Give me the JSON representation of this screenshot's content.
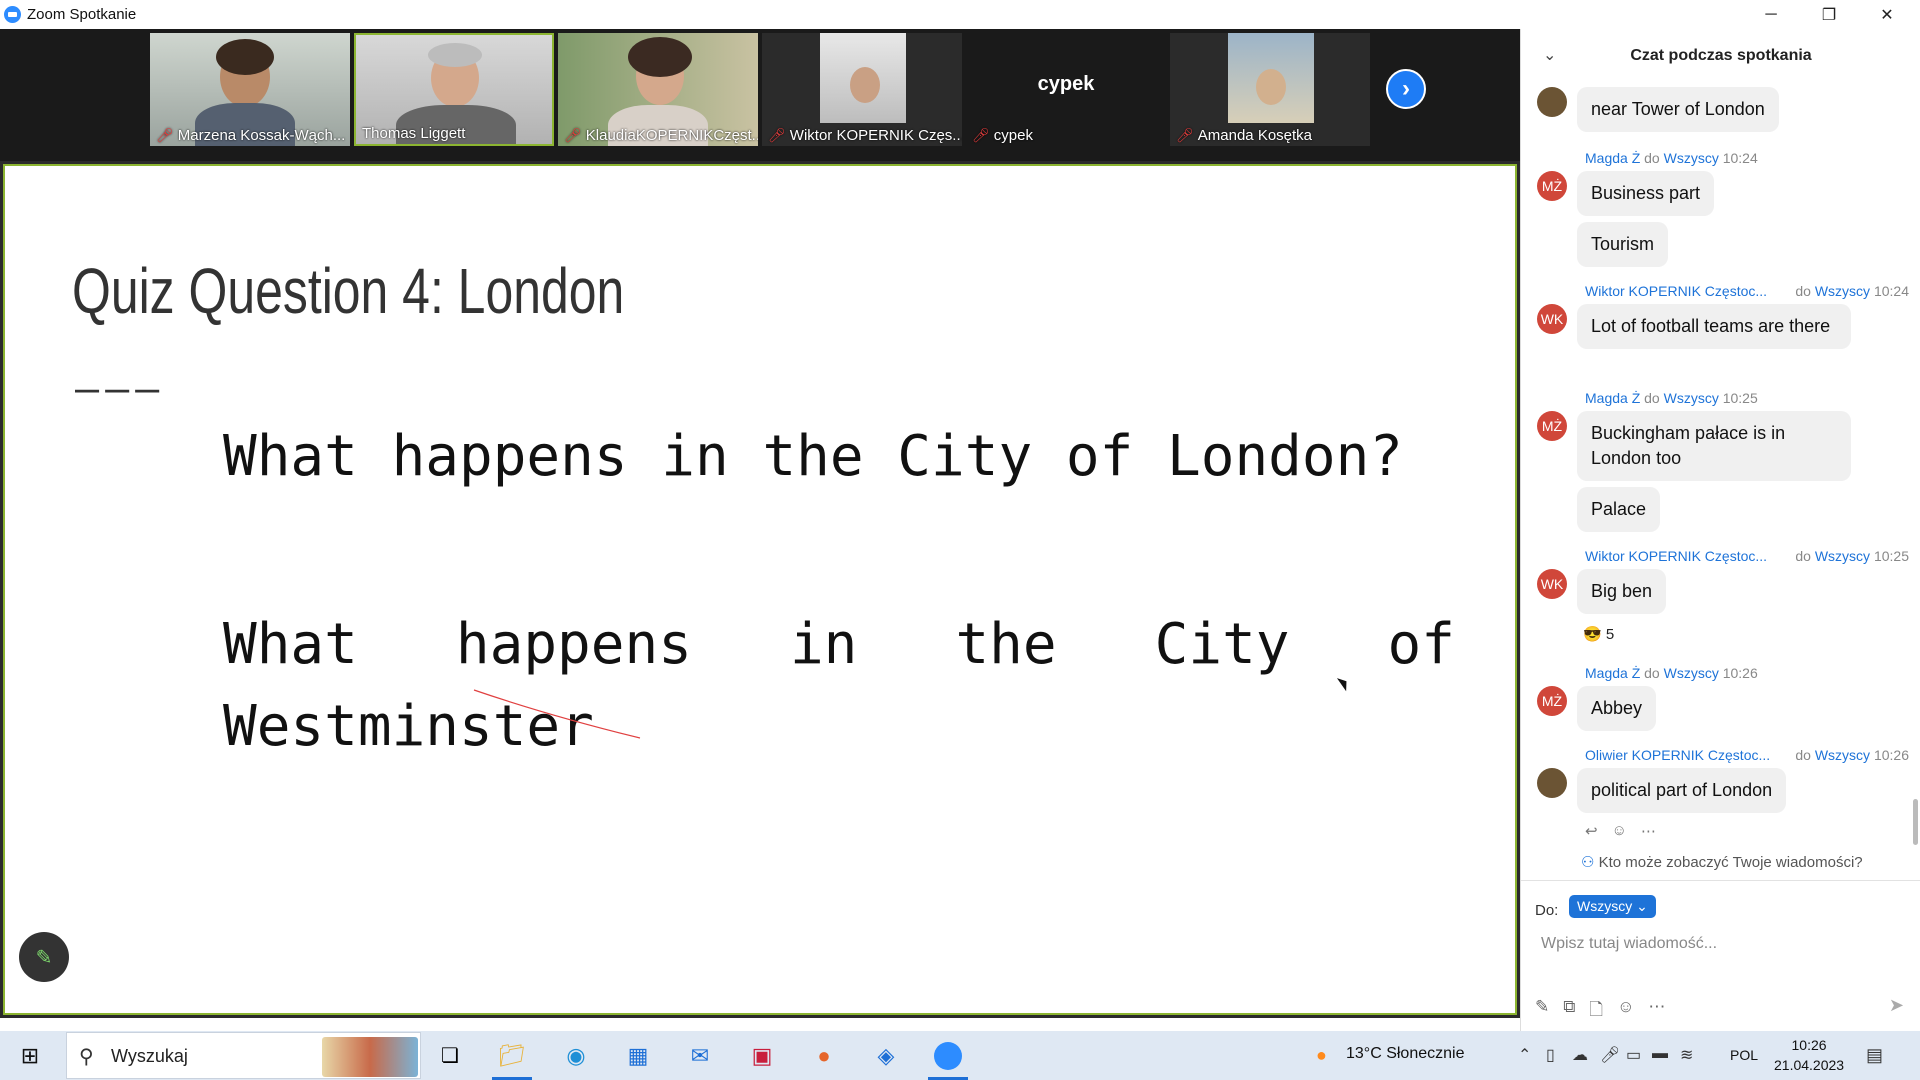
{
  "window": {
    "title": "Zoom Spotkanie",
    "minimize": "─",
    "maximize": "❐",
    "close": "✕"
  },
  "participants": [
    {
      "name": "Marzena Kossak-Wąch...",
      "muted": true
    },
    {
      "name": "Thomas Liggett",
      "muted": false
    },
    {
      "name": "KlaudiaKOPERNIKCzęst...",
      "muted": true
    },
    {
      "name": "Wiktor KOPERNIK Częs...",
      "muted": true
    },
    {
      "name": "cypek",
      "muted": true,
      "video_label": "cypek"
    },
    {
      "name": "Amanda Kosętka",
      "muted": true
    }
  ],
  "slide": {
    "title": "Quiz Question 4: London",
    "dashes": "———",
    "line1": "What happens in the City of London?",
    "line2": "What happens in the City of Westminster"
  },
  "chat": {
    "header": "Czat podczas spotkania",
    "messages": [
      {
        "avatar": "",
        "sender": "",
        "to": "",
        "time": "",
        "text": "near Tower of London"
      },
      {
        "avatar": "MŻ",
        "sender": "Magda Ż",
        "to_word": "do",
        "to": "Wszyscy",
        "time": "10:24",
        "texts": [
          "Business part",
          "Tourism"
        ]
      },
      {
        "avatar": "WK",
        "sender": "Wiktor KOPERNIK Częstoc...",
        "to_word": "do",
        "to": "Wszyscy",
        "time": "10:24",
        "texts": [
          "Lot of football teams are there"
        ]
      },
      {
        "avatar": "MŻ",
        "sender": "Magda Ż",
        "to_word": "do",
        "to": "Wszyscy",
        "time": "10:25",
        "texts": [
          "Buckingham pałace is in London too",
          "Palace"
        ]
      },
      {
        "avatar": "WK",
        "sender": "Wiktor KOPERNIK Częstoc...",
        "to_word": "do",
        "to": "Wszyscy",
        "time": "10:25",
        "texts": [
          "Big ben"
        ],
        "reaction": "😎 5"
      },
      {
        "avatar": "MŻ",
        "sender": "Magda Ż",
        "to_word": "do",
        "to": "Wszyscy",
        "time": "10:26",
        "texts": [
          "Abbey"
        ]
      },
      {
        "avatar": "",
        "sender": "Oliwier KOPERNIK Częstoc...",
        "to_word": "do",
        "to": "Wszyscy",
        "time": "10:26",
        "texts": [
          "political part of London"
        ]
      }
    ],
    "visibility": "Kto może zobaczyć Twoje wiadomości?",
    "to_label": "Do:",
    "to_value": "Wszyscy",
    "placeholder": "Wpisz tutaj wiadomość..."
  },
  "taskbar": {
    "search_placeholder": "Wyszukaj",
    "weather": "13°C  Słonecznie",
    "lang": "POL",
    "time": "10:26",
    "date": "21.04.2023"
  }
}
